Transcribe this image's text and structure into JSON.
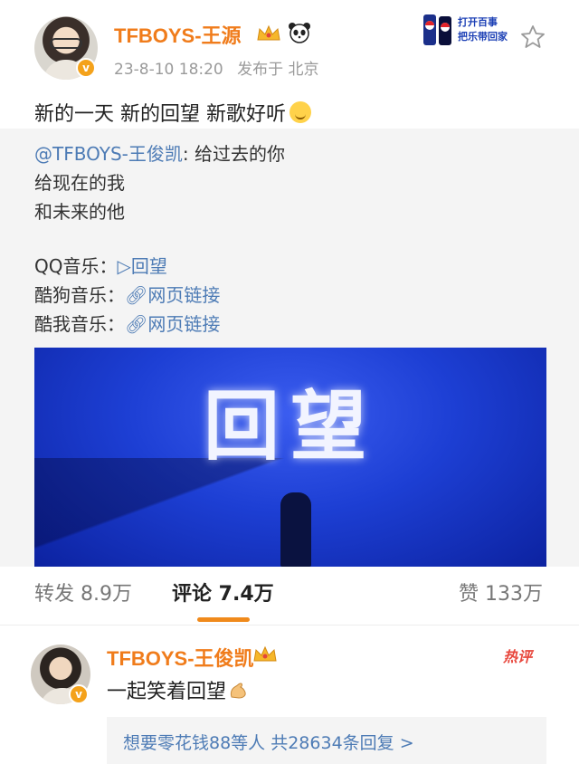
{
  "post": {
    "username": "TFBOYS-王源",
    "date": "23-8-10 18:20",
    "source": "发布于 北京",
    "text": "新的一天 新的回望 新歌好听"
  },
  "repost": {
    "mention": "@TFBOYS-王俊凯",
    "line1_rest": ": 给过去的你",
    "line2": "给现在的我",
    "line3": "和未来的他",
    "qq_label": "QQ音乐：",
    "qq_link": "▷回望",
    "kugou_label": "酷狗音乐：",
    "kugou_link": "网页链接",
    "kuwo_label": "酷我音乐：",
    "kuwo_link": "网页链接",
    "cover_title": "回望"
  },
  "tabs": {
    "repost": "转发 8.9万",
    "comment": "评论 7.4万",
    "like": "赞 133万"
  },
  "comment": {
    "username": "TFBOYS-王俊凯",
    "hot_label": "热评",
    "text": "一起笑着回望",
    "reply_summary": "想要零花钱88等人  共28634条回复  >"
  },
  "ad": {
    "text": "打开百事 把乐带回家"
  },
  "colors": {
    "accent": "#f07c1b",
    "link": "#4d7bb5",
    "hot": "#e8473d"
  }
}
